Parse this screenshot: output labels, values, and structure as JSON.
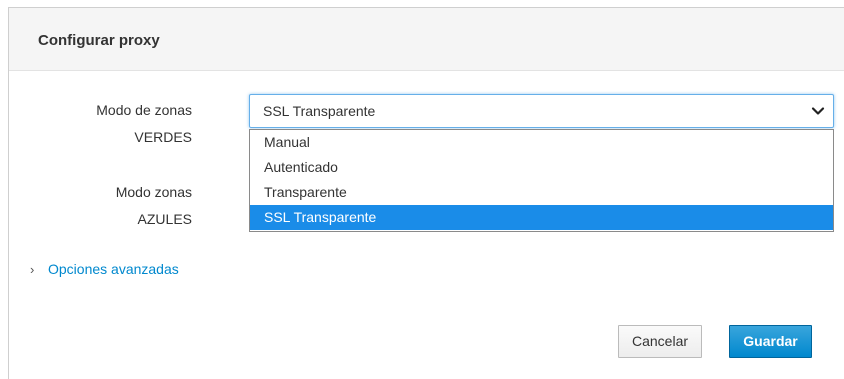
{
  "dialog": {
    "title": "Configurar proxy",
    "green_label_line1": "Modo de zonas",
    "green_label_line2": "VERDES",
    "blue_label_line1": "Modo zonas",
    "blue_label_line2": "AZULES",
    "select_value": "SSL Transparente",
    "options": [
      "Manual",
      "Autenticado",
      "Transparente",
      "SSL Transparente"
    ],
    "selected_index": 3,
    "advanced_link": "Opciones avanzadas",
    "cancel_label": "Cancelar",
    "save_label": "Guardar"
  },
  "colors": {
    "accent": "#0088ce",
    "selected_option": "#1a8ce8",
    "header_bg": "#f5f5f5"
  },
  "icons": [
    "chevron-down-icon",
    "chevron-right-icon"
  ]
}
